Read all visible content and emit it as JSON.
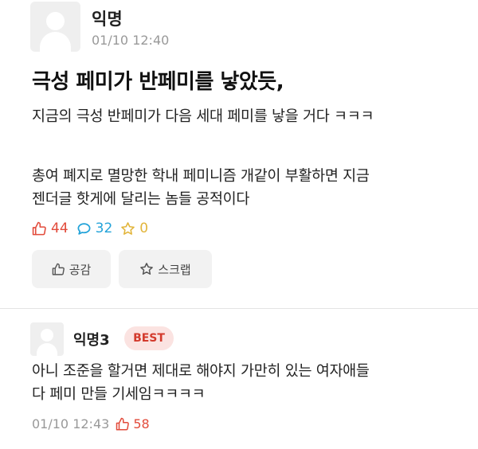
{
  "post": {
    "author": "익명",
    "date": "01/10 12:40",
    "title": "극성 페미가 반페미를 낳았듯,",
    "body": [
      "지금의 극성 반페미가 다음 세대 페미를 낳을 거다 ㅋㅋㅋ",
      "총여 폐지로 멸망한 학내 페미니즘 개같이 부활하면 지금",
      "젠더글 핫게에 달리는 놈들 공적이다"
    ],
    "stats": {
      "likes": "44",
      "comments": "32",
      "scraps": "0"
    },
    "actions": {
      "empathy": "공감",
      "scrap": "스크랩"
    }
  },
  "comment": {
    "author": "익명3",
    "badge": "BEST",
    "body": [
      "아니 조준을 할거면 제대로 해야지 가만히 있는 여자애들",
      "다 페미 만들 기세임ㅋㅋㅋㅋ"
    ],
    "date": "01/10 12:43",
    "likes": "58"
  },
  "colors": {
    "like": "#e24b3b",
    "comment": "#23a3d9",
    "scrap": "#e2b53b",
    "badge_bg": "#fbe3e1",
    "badge_text": "#d33a2c"
  },
  "icons": [
    "thumbs-up-icon",
    "speech-bubble-icon",
    "star-icon"
  ]
}
